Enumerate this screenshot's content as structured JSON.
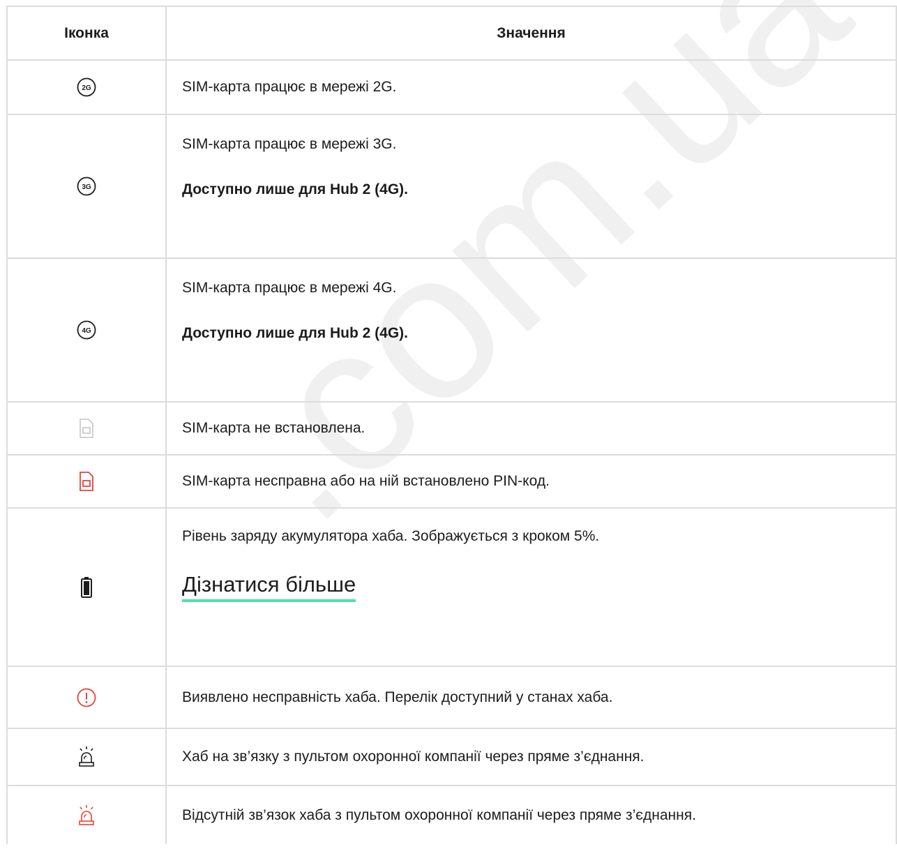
{
  "table": {
    "headers": {
      "icon": "Іконка",
      "meaning": "Значення"
    },
    "rows": [
      {
        "icon": "network-2g-icon",
        "icon_label": "2G",
        "lines": [
          "SIM-карта працює в мережі 2G."
        ]
      },
      {
        "icon": "network-3g-icon",
        "icon_label": "3G",
        "lines": [
          "SIM-карта працює в мережі 3G."
        ],
        "bold_note": "Доступно лише для Hub 2 (4G)."
      },
      {
        "icon": "network-4g-icon",
        "icon_label": "4G",
        "lines": [
          "SIM-карта працює в мережі 4G."
        ],
        "bold_note": "Доступно лише для Hub 2 (4G)."
      },
      {
        "icon": "sim-absent-icon",
        "lines": [
          "SIM-карта не встановлена."
        ]
      },
      {
        "icon": "sim-error-icon",
        "lines": [
          "SIM-карта несправна або на ній встановлено PIN-код."
        ]
      },
      {
        "icon": "battery-icon",
        "lines": [
          "Рівень заряду акумулятора хаба. Зображується з кроком 5%."
        ],
        "link": "Дізнатися більше"
      },
      {
        "icon": "malfunction-icon",
        "lines": [
          "Виявлено несправність хаба. Перелік доступний у станах хаба."
        ]
      },
      {
        "icon": "siren-ok-icon",
        "lines": [
          "Хаб на зв’язку з пультом охоронної компанії через пряме з’єднання."
        ]
      },
      {
        "icon": "siren-lost-icon",
        "lines": [
          "Відсутній зв’язок хаба з пультом охоронної компанії через пряме з’єднання."
        ]
      }
    ]
  },
  "colors": {
    "border": "#dcdcdc",
    "alert_red": "#e5433c",
    "link_underline": "#4fe0a6",
    "muted_gray": "#c4c4c4"
  },
  "watermark": ".com.ua"
}
